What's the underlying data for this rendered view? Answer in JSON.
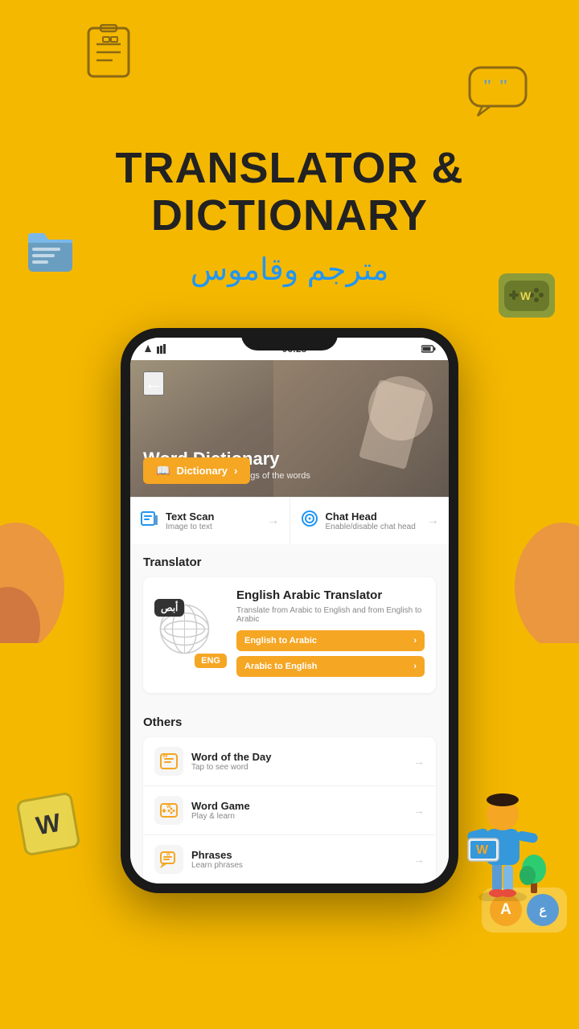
{
  "app": {
    "title": "Translator & Dictionary",
    "arabic_title": "مترجم وقاموس",
    "headline_line1": "TRANSLATOR &",
    "headline_line2": "DICTIONARY"
  },
  "phone": {
    "status_time": "06:25",
    "hero": {
      "back_button": "←",
      "screen_title": "Word Dictionary",
      "screen_subtitle": "Tap here to find the meanings  of the words"
    },
    "dictionary_button": "Dictionary",
    "features": {
      "text_scan": {
        "label": "Text Scan",
        "sublabel": "Image to text"
      },
      "chat_head": {
        "label": "Chat Head",
        "sublabel": "Enable/disable chat head"
      }
    },
    "translator": {
      "section_title": "Translator",
      "card_title": "English Arabic Translator",
      "card_desc": "Translate from Arabic to English and from English to Arabic",
      "arabic_badge": "أبص",
      "eng_badge": "ENG",
      "btn1": "English to Arabic",
      "btn2": "Arabic to English"
    },
    "others": {
      "section_title": "Others",
      "items": [
        {
          "label": "Word of the Day",
          "sublabel": "Tap to see word",
          "icon": "📋"
        },
        {
          "label": "Word Game",
          "sublabel": "Play & learn",
          "icon": "🎮"
        },
        {
          "label": "Phrases",
          "sublabel": "Learn phrases",
          "icon": "💬"
        }
      ]
    }
  },
  "word_game_text": "Word Game Play earn"
}
